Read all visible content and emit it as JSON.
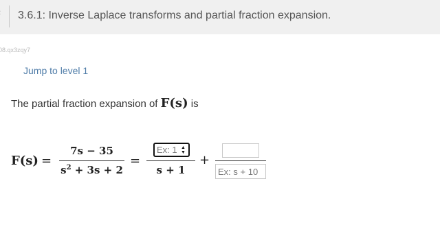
{
  "header": {
    "edge_glyph": "‹",
    "title": "3.6.1: Inverse Laplace transforms and partial fraction expansion."
  },
  "activity_id": "08.qx3zqy7",
  "jump_link": "Jump to level 1",
  "prompt": {
    "text": "The partial fraction expansion of",
    "math": "F(s)",
    "suffix": "is"
  },
  "equation": {
    "lhs": "F(s)",
    "equals": "=",
    "numerator": "7s − 35",
    "denominator_base": "s",
    "denominator_exp": "2",
    "denominator_rest": " + 3s + 2",
    "term1_numerator_placeholder": "Ex: 1",
    "term1_denominator": "s + 1",
    "plus": "+",
    "term2_numerator_value": "",
    "term2_denominator_placeholder": "Ex: s + 10"
  },
  "icons": {
    "spinner": "updown-spinner-icon"
  }
}
